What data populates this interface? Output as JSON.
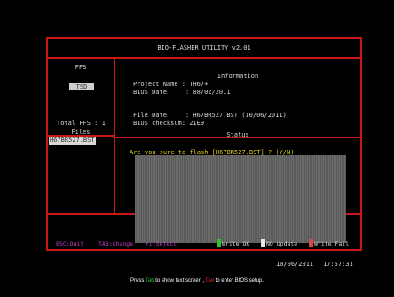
{
  "window": {
    "title": "BIO-FLASHER UTILITY v2.01"
  },
  "ffs": {
    "header": "FFS",
    "button": "TSD",
    "total": "Total FFS : 1"
  },
  "files": {
    "header": "Files",
    "selected": "H67BR527.BST"
  },
  "information": {
    "header": "Information",
    "project_name": "Project Name : TH67+",
    "bios_date": "BIOS Date     : 08/02/2011",
    "file_date": "File Date     : H67BR527.BST (10/06/2011)",
    "bios_checksum": "BIOS checksum: 21E9"
  },
  "status": {
    "header": "Status",
    "prompt": "Are you sure to flash [H67BR527.BST] ? (Y/N)"
  },
  "hints": {
    "esc": "ESC:Quit",
    "tab": "TAB:Change",
    "select": "↑↓:Select"
  },
  "legend": {
    "write_ok": "Write OK",
    "no_update": "NO Update",
    "write_fail": "Write Fail"
  },
  "clock": {
    "date": "10/06/2011",
    "time": "17:57:33"
  },
  "footer": {
    "press": "Press ",
    "tab": "Tab",
    "mid": " to show text screen , ",
    "del": "Del",
    "end": " to enter BIOS setup."
  },
  "colors": {
    "border": "#c81818",
    "write_ok": "#30c030",
    "no_update": "#e8e8e8",
    "write_fail": "#e04848",
    "hint": "#c040c0",
    "prompt": "#e0d020"
  }
}
